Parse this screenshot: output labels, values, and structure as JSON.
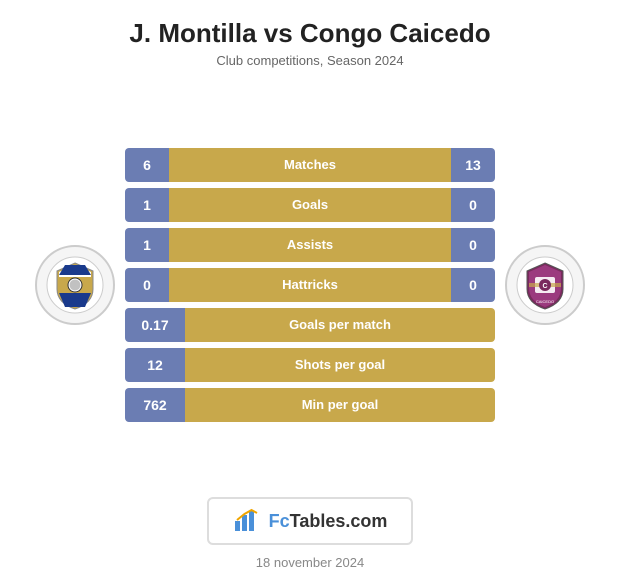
{
  "header": {
    "title": "J. Montilla vs Congo Caicedo",
    "subtitle": "Club competitions, Season 2024"
  },
  "stats": {
    "dual": [
      {
        "label": "Matches",
        "left": "6",
        "right": "13"
      },
      {
        "label": "Goals",
        "left": "1",
        "right": "0"
      },
      {
        "label": "Assists",
        "left": "1",
        "right": "0"
      },
      {
        "label": "Hattricks",
        "left": "0",
        "right": "0"
      }
    ],
    "single": [
      {
        "label": "Goals per match",
        "value": "0.17"
      },
      {
        "label": "Shots per goal",
        "value": "12"
      },
      {
        "label": "Min per goal",
        "value": "762"
      }
    ]
  },
  "badge": {
    "icon": "chart-icon",
    "text_fc": "Fc",
    "text_tables": "Tables.com",
    "full": "FcTables.com"
  },
  "footer": {
    "date": "18 november 2024"
  }
}
